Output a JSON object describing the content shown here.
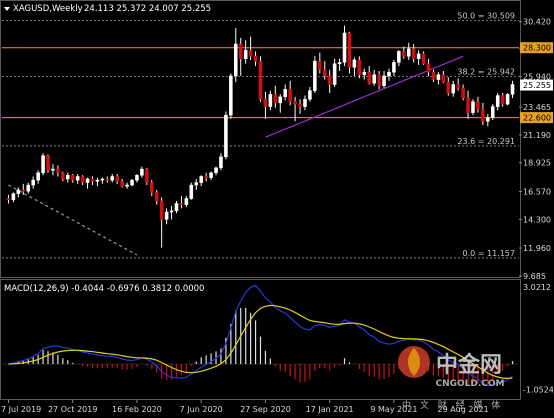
{
  "header": {
    "symbol": "XAGUSD,Weekly",
    "ohlc": "24.113 25.372 24.007 25.255"
  },
  "macd_header": "MACD(12,26,9) -0.4044 -0.6976 0.3812 0.0000",
  "chart_data": {
    "type": "candlestick",
    "price_axis": {
      "ticks": [
        "30.420",
        "28.190",
        "25.940",
        "23.465",
        "21.190",
        "18.925",
        "16.570",
        "14.300",
        "11.960",
        "9.685"
      ],
      "range": [
        9.685,
        31.7
      ]
    },
    "macd_axis": {
      "ticks": [
        "3.0212",
        "-1.0524"
      ],
      "range": [
        -1.25,
        3.0212
      ]
    },
    "x_axis": {
      "ticks": [
        "7 Jul 2019",
        "27 Oct 2019",
        "16 Feb 2020",
        "7 Jun 2020",
        "27 Sep 2020",
        "17 Jan 2021",
        "9 May 2021",
        "29 Aug 2021"
      ]
    },
    "price_tags": [
      {
        "value": 28.3,
        "label": "28.300",
        "color": "#e8a020"
      },
      {
        "value": 25.255,
        "label": "25.255",
        "color": "#ffffff"
      },
      {
        "value": 22.6,
        "label": "22.600",
        "color": "#e8a020"
      }
    ],
    "horizontal_lines": [
      {
        "value": 28.3,
        "color": "#e8a020"
      },
      {
        "value": 22.6,
        "color": "#e8a020"
      }
    ],
    "fib_levels": [
      {
        "value": 30.509,
        "label": "50.0 = 30.509"
      },
      {
        "value": 25.942,
        "label": "38.2 = 25.942"
      },
      {
        "value": 20.291,
        "label": "23.6 = 20.291"
      },
      {
        "value": 11.157,
        "label": "0.0 = 11.157"
      }
    ],
    "trendlines": [
      {
        "color": "#9a2fd0",
        "dashed": false,
        "from": [
          "27 Sep 2020",
          21.0
        ],
        "to": [
          "29 Aug 2021",
          27.6
        ]
      },
      {
        "color": "#9a9a9a",
        "dashed": true,
        "from": [
          "7 Jul 2019",
          17.1
        ],
        "to": [
          "16 Feb 2020",
          11.4
        ]
      }
    ],
    "candles": [
      [
        16.0,
        16.3,
        15.6,
        15.9
      ],
      [
        15.9,
        16.5,
        15.7,
        16.4
      ],
      [
        16.4,
        16.9,
        16.1,
        16.7
      ],
      [
        16.7,
        17.2,
        16.3,
        16.6
      ],
      [
        16.6,
        17.3,
        16.4,
        17.1
      ],
      [
        17.1,
        17.8,
        16.8,
        17.5
      ],
      [
        17.5,
        18.3,
        17.2,
        18.1
      ],
      [
        18.1,
        19.7,
        17.9,
        19.5
      ],
      [
        19.5,
        19.6,
        18.1,
        18.3
      ],
      [
        18.3,
        18.8,
        17.9,
        18.4
      ],
      [
        18.4,
        18.7,
        17.8,
        18.1
      ],
      [
        18.1,
        18.2,
        17.4,
        17.6
      ],
      [
        17.6,
        18.1,
        17.3,
        17.9
      ],
      [
        17.9,
        18.0,
        17.3,
        17.5
      ],
      [
        17.5,
        18.0,
        17.2,
        17.8
      ],
      [
        17.8,
        17.9,
        17.1,
        17.3
      ],
      [
        17.3,
        17.7,
        16.8,
        17.6
      ],
      [
        17.6,
        17.8,
        17.1,
        17.4
      ],
      [
        17.4,
        17.7,
        17.0,
        17.5
      ],
      [
        17.5,
        17.7,
        17.2,
        17.6
      ],
      [
        17.6,
        17.8,
        17.3,
        17.5
      ],
      [
        17.5,
        18.0,
        17.3,
        17.8
      ],
      [
        17.8,
        18.0,
        17.2,
        17.4
      ],
      [
        17.4,
        17.6,
        16.9,
        17.0
      ],
      [
        17.0,
        17.3,
        16.8,
        17.1
      ],
      [
        17.1,
        17.6,
        17.0,
        17.5
      ],
      [
        17.5,
        18.0,
        17.3,
        17.9
      ],
      [
        17.9,
        18.6,
        17.7,
        18.4
      ],
      [
        18.4,
        18.5,
        17.1,
        17.3
      ],
      [
        17.3,
        17.5,
        16.2,
        16.5
      ],
      [
        16.5,
        16.7,
        15.5,
        15.8
      ],
      [
        15.8,
        16.1,
        12.0,
        14.3
      ],
      [
        14.3,
        15.2,
        13.9,
        14.9
      ],
      [
        14.9,
        15.4,
        14.3,
        15.0
      ],
      [
        15.0,
        15.8,
        14.8,
        15.6
      ],
      [
        15.6,
        16.2,
        15.2,
        15.5
      ],
      [
        15.5,
        16.2,
        15.3,
        16.0
      ],
      [
        16.0,
        17.3,
        15.9,
        17.1
      ],
      [
        17.1,
        17.6,
        16.7,
        17.3
      ],
      [
        17.3,
        17.9,
        17.0,
        17.8
      ],
      [
        17.8,
        18.1,
        17.4,
        17.7
      ],
      [
        17.7,
        18.2,
        17.5,
        18.1
      ],
      [
        18.1,
        18.6,
        17.9,
        18.5
      ],
      [
        18.5,
        19.7,
        18.3,
        19.4
      ],
      [
        19.4,
        23.1,
        19.2,
        22.8
      ],
      [
        22.8,
        26.2,
        22.5,
        26.0
      ],
      [
        26.0,
        29.9,
        25.5,
        28.6
      ],
      [
        28.6,
        29.1,
        26.0,
        27.4
      ],
      [
        27.4,
        28.9,
        27.0,
        28.1
      ],
      [
        28.1,
        29.2,
        27.3,
        27.6
      ],
      [
        27.6,
        28.0,
        26.8,
        27.2
      ],
      [
        27.2,
        27.6,
        23.9,
        24.1
      ],
      [
        24.1,
        24.7,
        22.5,
        23.5
      ],
      [
        23.5,
        24.8,
        23.2,
        24.5
      ],
      [
        24.5,
        25.2,
        23.4,
        23.8
      ],
      [
        23.8,
        24.5,
        23.0,
        24.3
      ],
      [
        24.3,
        25.3,
        24.0,
        24.9
      ],
      [
        24.9,
        25.6,
        23.6,
        23.9
      ],
      [
        23.9,
        24.3,
        22.3,
        23.7
      ],
      [
        23.7,
        24.1,
        22.9,
        23.5
      ],
      [
        23.5,
        24.4,
        23.2,
        24.1
      ],
      [
        24.1,
        25.1,
        23.9,
        24.8
      ],
      [
        24.8,
        27.6,
        24.6,
        27.2
      ],
      [
        27.2,
        27.9,
        26.2,
        26.5
      ],
      [
        26.5,
        27.2,
        25.7,
        26.0
      ],
      [
        26.0,
        26.5,
        24.6,
        25.3
      ],
      [
        25.3,
        27.4,
        25.1,
        27.0
      ],
      [
        27.0,
        27.4,
        26.4,
        27.1
      ],
      [
        27.1,
        30.1,
        26.8,
        29.5
      ],
      [
        29.5,
        29.6,
        26.2,
        26.7
      ],
      [
        26.7,
        27.5,
        26.0,
        27.3
      ],
      [
        27.3,
        27.6,
        25.8,
        26.1
      ],
      [
        26.1,
        26.6,
        25.7,
        26.3
      ],
      [
        26.3,
        26.8,
        25.3,
        25.4
      ],
      [
        25.4,
        26.5,
        25.2,
        26.1
      ],
      [
        26.1,
        26.4,
        24.9,
        25.2
      ],
      [
        25.2,
        26.4,
        25.0,
        26.0
      ],
      [
        26.0,
        26.6,
        25.6,
        26.3
      ],
      [
        26.3,
        27.3,
        26.0,
        27.1
      ],
      [
        27.1,
        28.1,
        26.8,
        28.0
      ],
      [
        28.0,
        28.4,
        27.4,
        27.6
      ],
      [
        27.6,
        28.7,
        27.3,
        28.2
      ],
      [
        28.2,
        28.6,
        27.1,
        27.4
      ],
      [
        27.4,
        28.1,
        26.9,
        27.8
      ],
      [
        27.8,
        28.0,
        26.9,
        27.0
      ],
      [
        27.0,
        27.4,
        26.0,
        26.3
      ],
      [
        26.3,
        26.5,
        25.5,
        25.7
      ],
      [
        25.7,
        26.3,
        25.3,
        26.1
      ],
      [
        26.1,
        26.4,
        25.4,
        25.5
      ],
      [
        25.5,
        25.9,
        24.4,
        24.6
      ],
      [
        24.6,
        25.6,
        24.3,
        25.3
      ],
      [
        25.3,
        25.8,
        24.8,
        25.0
      ],
      [
        25.0,
        25.3,
        24.0,
        24.2
      ],
      [
        24.2,
        24.8,
        22.5,
        23.0
      ],
      [
        23.0,
        24.1,
        22.8,
        23.9
      ],
      [
        23.9,
        24.3,
        23.0,
        23.3
      ],
      [
        23.3,
        23.8,
        22.0,
        22.3
      ],
      [
        22.3,
        22.9,
        21.9,
        22.6
      ],
      [
        22.6,
        23.7,
        22.4,
        23.5
      ],
      [
        23.5,
        24.6,
        23.2,
        24.4
      ],
      [
        24.4,
        24.6,
        23.5,
        23.7
      ],
      [
        23.7,
        24.6,
        23.6,
        24.5
      ],
      [
        24.5,
        25.6,
        24.2,
        25.3
      ]
    ],
    "macd": {
      "main_line_color": "#2a37d8",
      "signal_line_color": "#e0d020"
    }
  },
  "watermark": {
    "logo_text": "中金网",
    "url": "CNGOLD.COM",
    "subtitle": "中 文 财 经 媒 体"
  }
}
